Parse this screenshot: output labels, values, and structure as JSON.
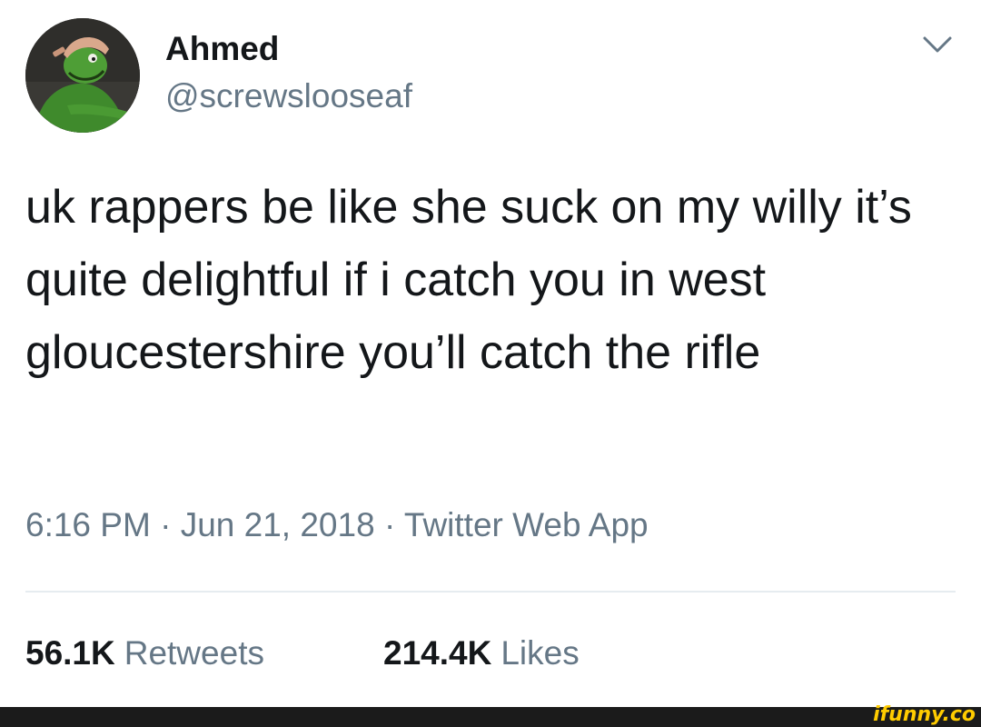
{
  "user": {
    "display_name": "Ahmed",
    "handle": "@screwslooseaf",
    "avatar_icon": "kermit-avatar"
  },
  "tweet": {
    "text": "uk rappers be like she suck on my willy it’s quite delightful if i catch you in west gloucestershire you’ll catch the rifle",
    "time": "6:16 PM",
    "date": "Jun 21, 2018",
    "source": "Twitter Web App",
    "separator": "·"
  },
  "stats": {
    "retweets_count": "56.1K",
    "retweets_label": "Retweets",
    "likes_count": "214.4K",
    "likes_label": "Likes"
  },
  "footer": {
    "watermark": "ifunny.co"
  },
  "colors": {
    "text_primary": "#14171a",
    "text_secondary": "#657786",
    "divider": "#e6ecf0",
    "watermark": "#ffcc00",
    "footer_bg": "#1b1b1b"
  }
}
